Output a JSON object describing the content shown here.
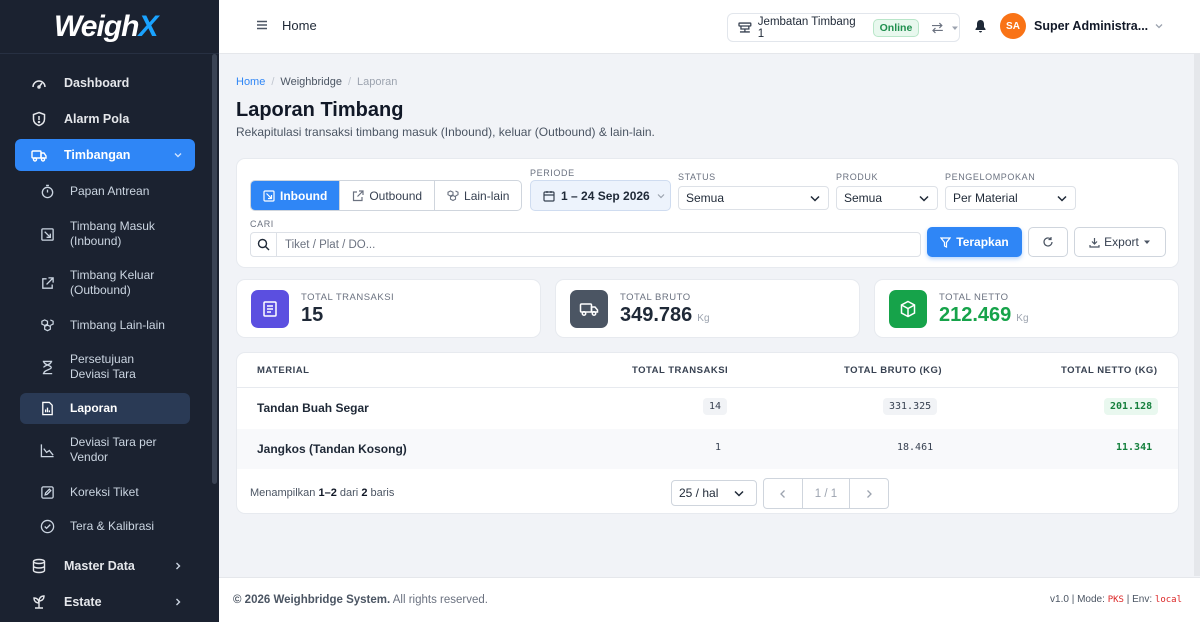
{
  "app": {
    "logo_text": "Weigh",
    "logo_accent": "X"
  },
  "sidebar": {
    "items": [
      {
        "label": "Dashboard",
        "icon": "gauge-icon"
      },
      {
        "label": "Alarm Pola",
        "icon": "shield-icon"
      },
      {
        "label": "Timbangan",
        "icon": "truck-icon",
        "active": true,
        "expanded": true
      },
      {
        "label": "Master Data",
        "icon": "database-icon"
      },
      {
        "label": "Estate",
        "icon": "plant-icon"
      }
    ],
    "sub_items": [
      {
        "label": "Papan Antrean",
        "icon": "stopwatch-icon"
      },
      {
        "label": "Timbang Masuk (Inbound)",
        "icon": "inbound-icon"
      },
      {
        "label": "Timbang Keluar (Outbound)",
        "icon": "outbound-icon"
      },
      {
        "label": "Timbang Lain-lain",
        "icon": "boxes-icon"
      },
      {
        "label": "Persetujuan Deviasi Tara",
        "icon": "hourglass-icon"
      },
      {
        "label": "Laporan",
        "icon": "report-icon",
        "active": true
      },
      {
        "label": "Deviasi Tara per Vendor",
        "icon": "chart-line-icon"
      },
      {
        "label": "Koreksi Tiket",
        "icon": "edit-icon"
      },
      {
        "label": "Tera & Kalibrasi",
        "icon": "check-circle-icon"
      }
    ]
  },
  "topbar": {
    "home_label": "Home",
    "weighbridge": "Jembatan Timbang 1",
    "status": "Online",
    "avatar_initials": "SA",
    "user_name": "Super Administra..."
  },
  "breadcrumb": [
    "Home",
    "Weighbridge",
    "Laporan"
  ],
  "page": {
    "title": "Laporan Timbang",
    "subtitle": "Rekapitulasi transaksi timbang masuk (Inbound), keluar (Outbound) & lain-lain."
  },
  "filters": {
    "tabs": [
      "Inbound",
      "Outbound",
      "Lain-lain"
    ],
    "active_tab": "Inbound",
    "periode_label": "PERIODE",
    "periode_value": "1 – 24 Sep 2026",
    "status_label": "STATUS",
    "status_value": "Semua",
    "produk_label": "PRODUK",
    "produk_value": "Semua",
    "group_label": "PENGELOMPOKAN",
    "group_value": "Per Material",
    "search_label": "CARI",
    "search_placeholder": "Tiket / Plat / DO...",
    "apply_label": "Terapkan",
    "export_label": "Export"
  },
  "stats": [
    {
      "label": "TOTAL TRANSAKSI",
      "value": "15",
      "unit": "",
      "color": "#5b4fe0",
      "icon": "receipt-icon"
    },
    {
      "label": "TOTAL BRUTO",
      "value": "349.786",
      "unit": "Kg",
      "color": "#4b5563",
      "icon": "truck-icon"
    },
    {
      "label": "TOTAL NETTO",
      "value": "212.469",
      "unit": "Kg",
      "color": "#16a34a",
      "icon": "box-icon"
    }
  ],
  "table": {
    "headers": [
      "MATERIAL",
      "TOTAL TRANSAKSI",
      "TOTAL BRUTO (KG)",
      "TOTAL NETTO (KG)"
    ],
    "rows": [
      [
        "Tandan Buah Segar",
        "14",
        "331.325",
        "201.128"
      ],
      [
        "Jangkos (Tandan Kosong)",
        "1",
        "18.461",
        "11.341"
      ]
    ]
  },
  "pagination": {
    "prefix": "Menampilkan ",
    "range": "1–2",
    "middle": " dari ",
    "total": "2",
    "suffix": " baris",
    "per_page": "25 / hal",
    "page_info": "1 / 1"
  },
  "footer": {
    "copyright": "© 2026 Weighbridge System.",
    "rights": " All rights reserved.",
    "version": "v1.0 | Mode: ",
    "mode": "PKS",
    "env_label": " | Env: ",
    "env": "local"
  }
}
